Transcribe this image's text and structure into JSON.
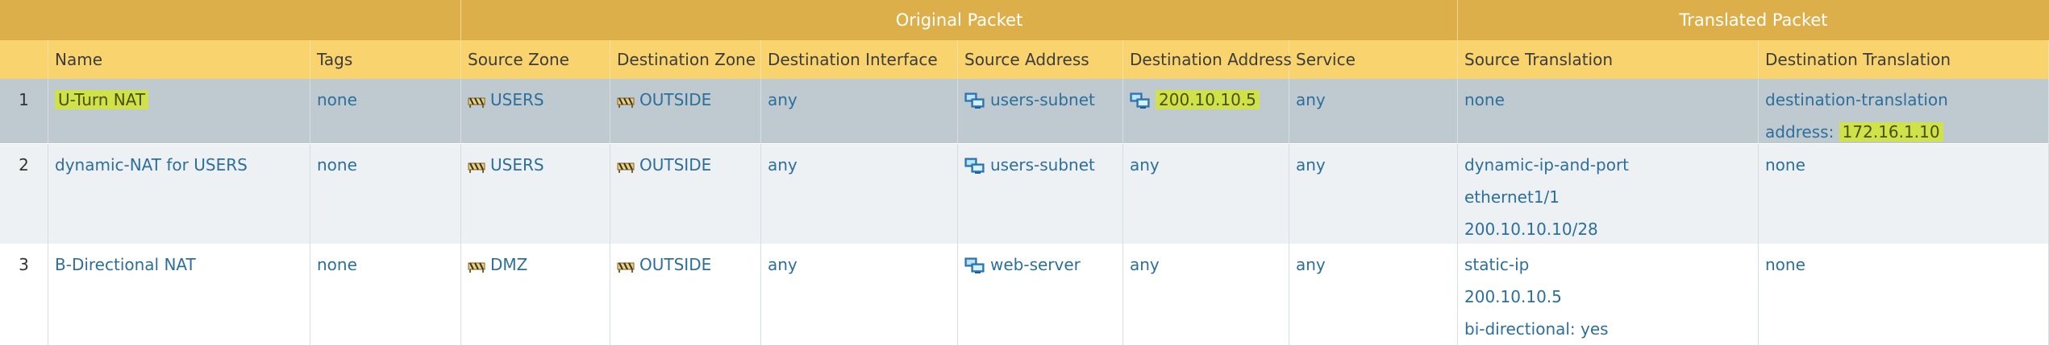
{
  "group_headers": {
    "original": "Original Packet",
    "translated": "Translated Packet"
  },
  "columns": [
    "",
    "Name",
    "Tags",
    "Source Zone",
    "Destination Zone",
    "Destination Interface",
    "Source Address",
    "Destination Address",
    "Service",
    "Source Translation",
    "Destination Translation"
  ],
  "rows": [
    {
      "num": "1",
      "name": "U-Turn NAT",
      "tags": "none",
      "source_zone": "USERS",
      "destination_zone": "OUTSIDE",
      "destination_interface": "any",
      "source_address": "users-subnet",
      "destination_address": "200.10.10.5",
      "service": "any",
      "source_translation": [
        "none"
      ],
      "destination_translation": {
        "line1": "destination-translation",
        "address_label": "address:",
        "address_value": "172.16.1.10"
      }
    },
    {
      "num": "2",
      "name": "dynamic-NAT for USERS",
      "tags": "none",
      "source_zone": "USERS",
      "destination_zone": "OUTSIDE",
      "destination_interface": "any",
      "source_address": "users-subnet",
      "destination_address": "any",
      "service": "any",
      "source_translation": [
        "dynamic-ip-and-port",
        "ethernet1/1",
        "200.10.10.10/28"
      ],
      "destination_translation_text": "none"
    },
    {
      "num": "3",
      "name": "B-Directional NAT",
      "tags": "none",
      "source_zone": "DMZ",
      "destination_zone": "OUTSIDE",
      "destination_interface": "any",
      "source_address": "web-server",
      "destination_address": "any",
      "service": "any",
      "source_translation": [
        "static-ip",
        "200.10.10.5",
        "bi-directional: yes"
      ],
      "destination_translation_text": "none"
    }
  ],
  "colors": {
    "group_header_bg": "#dcaf4a",
    "column_header_bg": "#f8d36e",
    "selected_row_bg": "#bfcad0",
    "highlight": "#cfe24a",
    "link_text": "#2c6f9c"
  },
  "icons": {
    "zone": "zone-icon",
    "address": "address-object-icon"
  }
}
